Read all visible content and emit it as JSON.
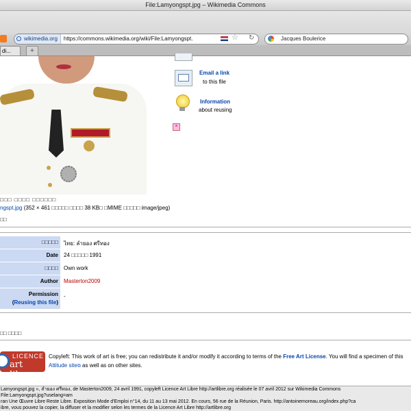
{
  "window": {
    "title": "File:Lamyongspt.jpg – Wikimedia Commons"
  },
  "toolbar": {
    "site_identity": "wikimedia.org",
    "url": "https://commons.wikimedia.org/wiki/File:Lamyongspt.",
    "search_text": "Jacques Boulerice",
    "search_engine_icon": "google-icon",
    "rss_icon": "rss-icon",
    "bookmark_icon": "star-icon",
    "reload_icon": "reload-icon"
  },
  "tabs": {
    "active_label": "di...",
    "new_tab_label": "+"
  },
  "share": {
    "email_link": "Email a link",
    "email_sub": "to this file",
    "info_link": "Information",
    "info_sub": "about reusing"
  },
  "file_info": {
    "resolution_line": "□□□ □□□□ □□□□□□",
    "file_link": "ngspt.jpg",
    "details_1": "(352 × 461 □□□□□ □□□□ 38 KB□ □MIME □□□□□ image/jpeg)",
    "glyph_row": "□□"
  },
  "info_table": {
    "rows": [
      {
        "label": "□□□□□",
        "value": "ไทย: ลำยอง ศรีทอง"
      },
      {
        "label": "Date",
        "value": "24 □□□□□ 1991"
      },
      {
        "label": "□□□□",
        "value": "Own work"
      },
      {
        "label": "Author",
        "value": "Masterton2009"
      },
      {
        "label": "Permission",
        "label2": "(Reusing this file)",
        "value": "-"
      }
    ]
  },
  "licensing": {
    "glyph_row": "□□ □□□□",
    "badge_top": "LICENCE",
    "badge_bottom": "art libre",
    "text_1": "Copyleft: This work of art is free; you can redistribute it and/or modify it according to terms of the ",
    "fal_link": "Free Art License",
    "text_2": ". You will find a specimen of this",
    "attitude_link": "Attitude site",
    "text_3": " as well as on other sites."
  },
  "caption": {
    "line1": "Lamyongspt.jpg », ลำยอง ศรีทอง, de Masterton2009,  24 avril 1991, copyleft Licence Art Libre http://artlibre.org réalisée le 07 avril 2012 sur Wikimedia Commons",
    "line2": "File:Lamyongspt.jpg?uselang=am",
    "line3": "ran Une Œuvre Libre Reste Libre. Exposition Mode d'Emploi n°14, du 11 au 13 mai 2012. En cours, 56 rue de la Réunion, Paris. http://antoinemoreau.org/index.php?ca",
    "line4": "ibre, vous pouvez la copier, la diffuser et la modifier selon les termes de la Licence Art Libre http://artlibre.org"
  }
}
